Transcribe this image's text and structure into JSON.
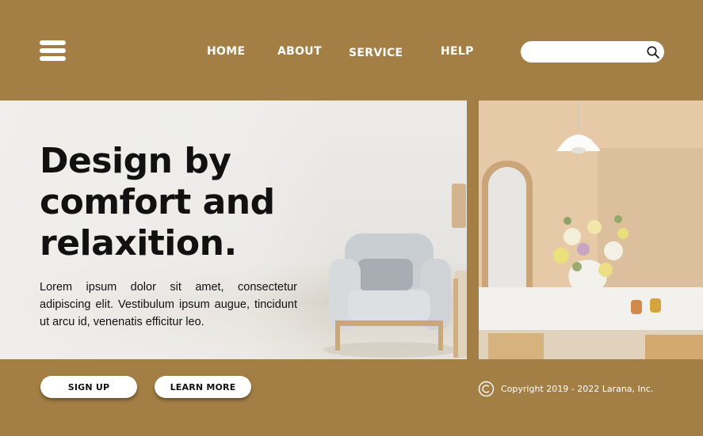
{
  "header": {
    "menu_icon": "hamburger-menu-icon",
    "nav": {
      "home": "HOME",
      "about": "ABOUT",
      "service": "SERVICE",
      "help": "HELP"
    },
    "search": {
      "value": "",
      "placeholder": "",
      "icon": "search-icon"
    }
  },
  "hero": {
    "title_lines": [
      "Design by",
      "comfort and",
      "relaxition."
    ],
    "description": "Lorem ipsum dolor sit amet, consectetur adipiscing elit. Vestibulum ipsum augue, tincidunt ut arcu id, venenatis efficitur leo."
  },
  "actions": {
    "signup_label": "SIGN UP",
    "learn_more_label": "LEARN MORE"
  },
  "footer": {
    "copyright_icon": "copyright-icon",
    "copyright_text": "Copyright 2019 - 2022 Larana, Inc."
  },
  "colors": {
    "brand": "#a37f45",
    "text_dark": "#111111",
    "white": "#ffffff"
  }
}
